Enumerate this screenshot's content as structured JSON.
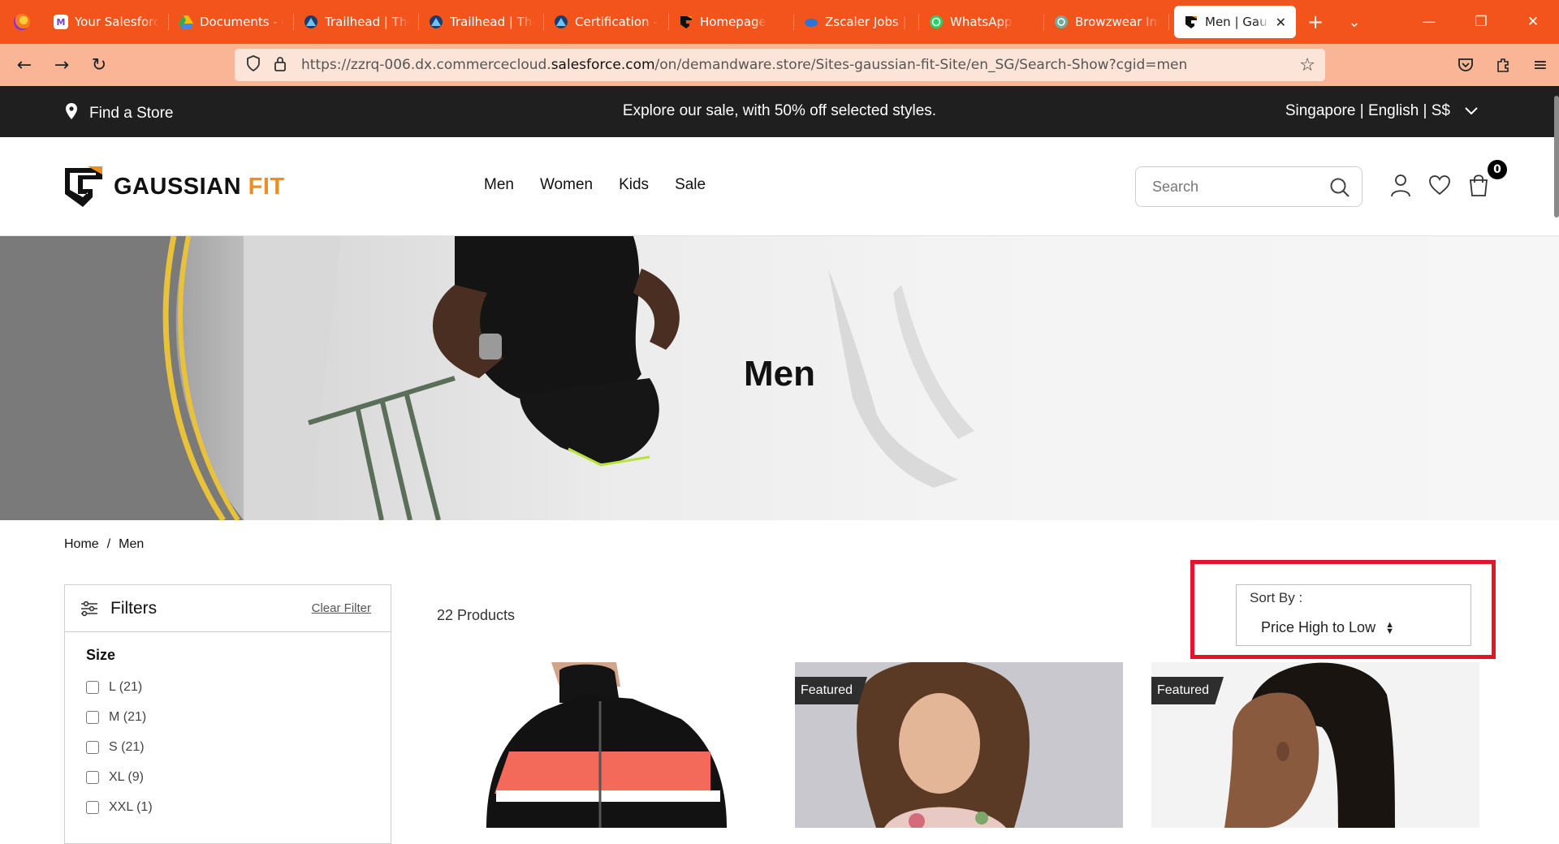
{
  "browser": {
    "tabs": [
      {
        "label": "Your Salesforce",
        "favicon": "salesforce-m"
      },
      {
        "label": "Documents - G",
        "favicon": "drive"
      },
      {
        "label": "Trailhead | The",
        "favicon": "trailhead"
      },
      {
        "label": "Trailhead | The",
        "favicon": "trailhead"
      },
      {
        "label": "Certification - A",
        "favicon": "trailhead"
      },
      {
        "label": "Homepage",
        "favicon": "gaussian"
      },
      {
        "label": "Zscaler Jobs | Z",
        "favicon": "zscaler"
      },
      {
        "label": "WhatsApp",
        "favicon": "whatsapp"
      },
      {
        "label": "Browzwear Inte",
        "favicon": "chatgpt"
      }
    ],
    "active_tab": {
      "label": "Men | Gaussian"
    },
    "url": {
      "prefix": "https://zzrq-006.dx.commercecloud.",
      "host": "salesforce.com",
      "path": "/on/demandware.store/Sites-gaussian-fit-Site/en_SG/Search-Show?cgid=men"
    },
    "colors": {
      "tabbar": "#f2541b",
      "navbar": "#f9b596"
    }
  },
  "promo": {
    "find_store": "Find a Store",
    "message": "Explore our sale, with 50% off selected styles.",
    "locale": "Singapore | English | S$"
  },
  "header": {
    "logo_main": "GAUSSIAN",
    "logo_accent": "FIT",
    "nav": [
      "Men",
      "Women",
      "Kids",
      "Sale"
    ],
    "search_placeholder": "Search",
    "cart_count": "0",
    "accent_color": "#f28c1c"
  },
  "hero": {
    "title": "Men"
  },
  "breadcrumb": {
    "home": "Home",
    "sep": "/",
    "current": "Men"
  },
  "filters": {
    "title": "Filters",
    "clear": "Clear Filter",
    "size_heading": "Size",
    "sizes": [
      "L (21)",
      "M (21)",
      "S (21)",
      "XL (9)",
      "XXL (1)"
    ]
  },
  "results": {
    "count": "22 Products"
  },
  "sort": {
    "label": "Sort By :",
    "value": "Price High to Low",
    "highlight_color": "#e0172a"
  },
  "products": [
    {
      "badge": ""
    },
    {
      "badge": "Featured"
    },
    {
      "badge": "Featured"
    }
  ]
}
